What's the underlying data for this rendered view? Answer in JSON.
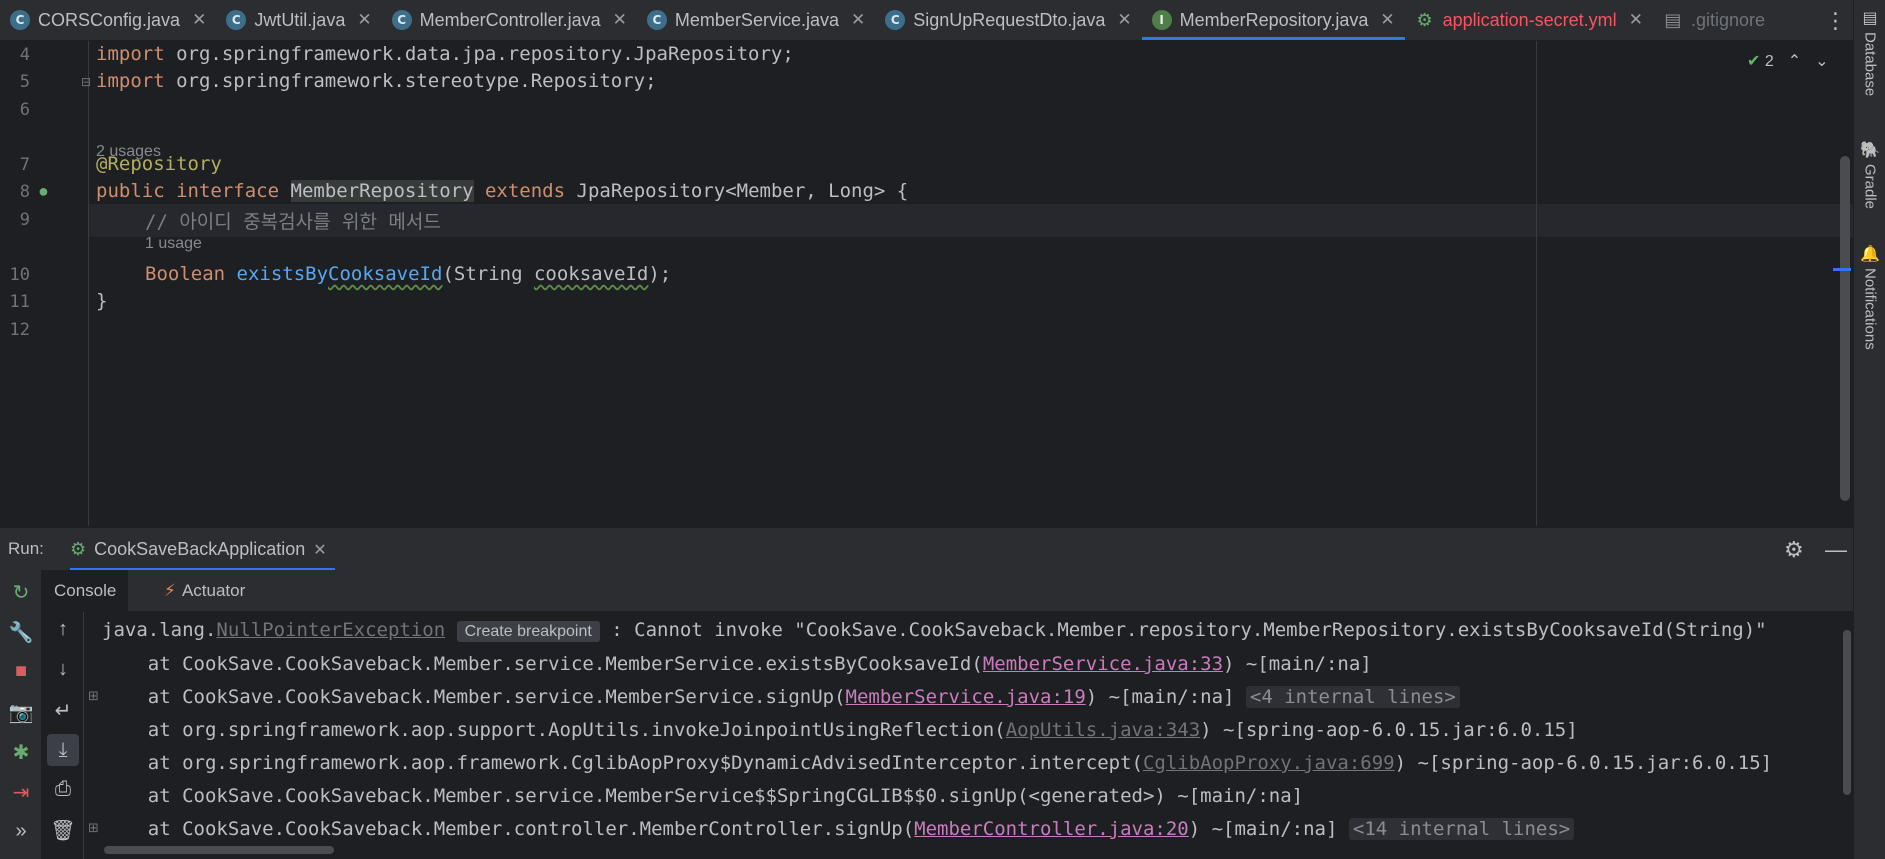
{
  "tabs": [
    {
      "label": "CORSConfig.java",
      "icon": "C",
      "kind": "class"
    },
    {
      "label": "JwtUtil.java",
      "icon": "C",
      "kind": "class"
    },
    {
      "label": "MemberController.java",
      "icon": "C",
      "kind": "class"
    },
    {
      "label": "MemberService.java",
      "icon": "C",
      "kind": "class"
    },
    {
      "label": "SignUpRequestDto.java",
      "icon": "C",
      "kind": "class"
    },
    {
      "label": "MemberRepository.java",
      "icon": "I",
      "kind": "interface",
      "active": true
    },
    {
      "label": "application-secret.yml",
      "icon": "yml",
      "kind": "yml"
    },
    {
      "label": ".gitignore",
      "icon": "git",
      "kind": "git"
    }
  ],
  "tab_close": "✕",
  "right_tools": {
    "database": "Database",
    "gradle": "Gradle",
    "notifications": "Notifications"
  },
  "inspection": {
    "count": "2"
  },
  "editor": {
    "line_numbers": [
      "4",
      "5",
      "6",
      "7",
      "8",
      "9",
      "10",
      "11",
      "12"
    ],
    "usage_hint_1": "2 usages",
    "usage_hint_2": "1 usage",
    "line4": {
      "kw": "import",
      "rest": " org.springframework.data.jpa.repository.JpaRepository;"
    },
    "line5": {
      "kw": "import",
      "rest": " org.springframework.stereotype.Repository;"
    },
    "line7": {
      "ann": "@Repository"
    },
    "line8": {
      "kw1": "public",
      "kw2": "interface",
      "name": "MemberRepository",
      "kw3": "extends",
      "rest": " JpaRepository<Member, Long> {"
    },
    "line9": {
      "comment": "// 아이디 중복검사를 위한 메서드"
    },
    "line10": {
      "type": "Boolean",
      "fn_prefix": "existsBy",
      "fn_underlined": "CooksaveId",
      "open": "(String ",
      "param": "cooksaveId",
      "close": ");"
    },
    "line11": {
      "brace": "}"
    }
  },
  "run": {
    "label": "Run:",
    "config": "CookSaveBackApplication",
    "close": "✕",
    "tabs": {
      "console": "Console",
      "actuator": "Actuator"
    }
  },
  "console": {
    "line1": {
      "prefix": "java.lang.",
      "exception": "NullPointerException",
      "badge": "Create breakpoint",
      "message": " : Cannot invoke \"CookSave.CookSaveback.Member.repository.MemberRepository.existsByCooksaveId(String)\""
    },
    "line2": {
      "text": "    at CookSave.CookSaveback.Member.service.MemberService.existsByCooksaveId(",
      "link": "MemberService.java:33",
      "after": ") ~[main/:na]"
    },
    "line3": {
      "text": "    at CookSave.CookSaveback.Member.service.MemberService.signUp(",
      "link": "MemberService.java:19",
      "after": ") ~[main/:na] ",
      "fold": "<4 internal lines>"
    },
    "line4": {
      "text": "    at org.springframework.aop.support.AopUtils.invokeJoinpointUsingReflection(",
      "link": "AopUtils.java:343",
      "after": ") ~[spring-aop-6.0.15.jar:6.0.15]"
    },
    "line5": {
      "text": "    at org.springframework.aop.framework.CglibAopProxy$DynamicAdvisedInterceptor.intercept(",
      "link": "CglibAopProxy.java:699",
      "after": ") ~[spring-aop-6.0.15.jar:6.0.15]"
    },
    "line6": {
      "text": "    at CookSave.CookSaveback.Member.service.MemberService$$SpringCGLIB$$0.signUp(<generated>) ~[main/:na]"
    },
    "line7": {
      "text": "    at CookSave.CookSaveback.Member.controller.MemberController.signUp(",
      "link": "MemberController.java:20",
      "after": ") ~[main/:na] ",
      "fold": "<14 internal lines>"
    }
  },
  "colors": {
    "accent": "#3574f0",
    "keyword": "#cf8e6d",
    "annotation": "#b3ae60",
    "function": "#56a8f5",
    "link": "#c77dbb",
    "background": "#1e1f22"
  }
}
